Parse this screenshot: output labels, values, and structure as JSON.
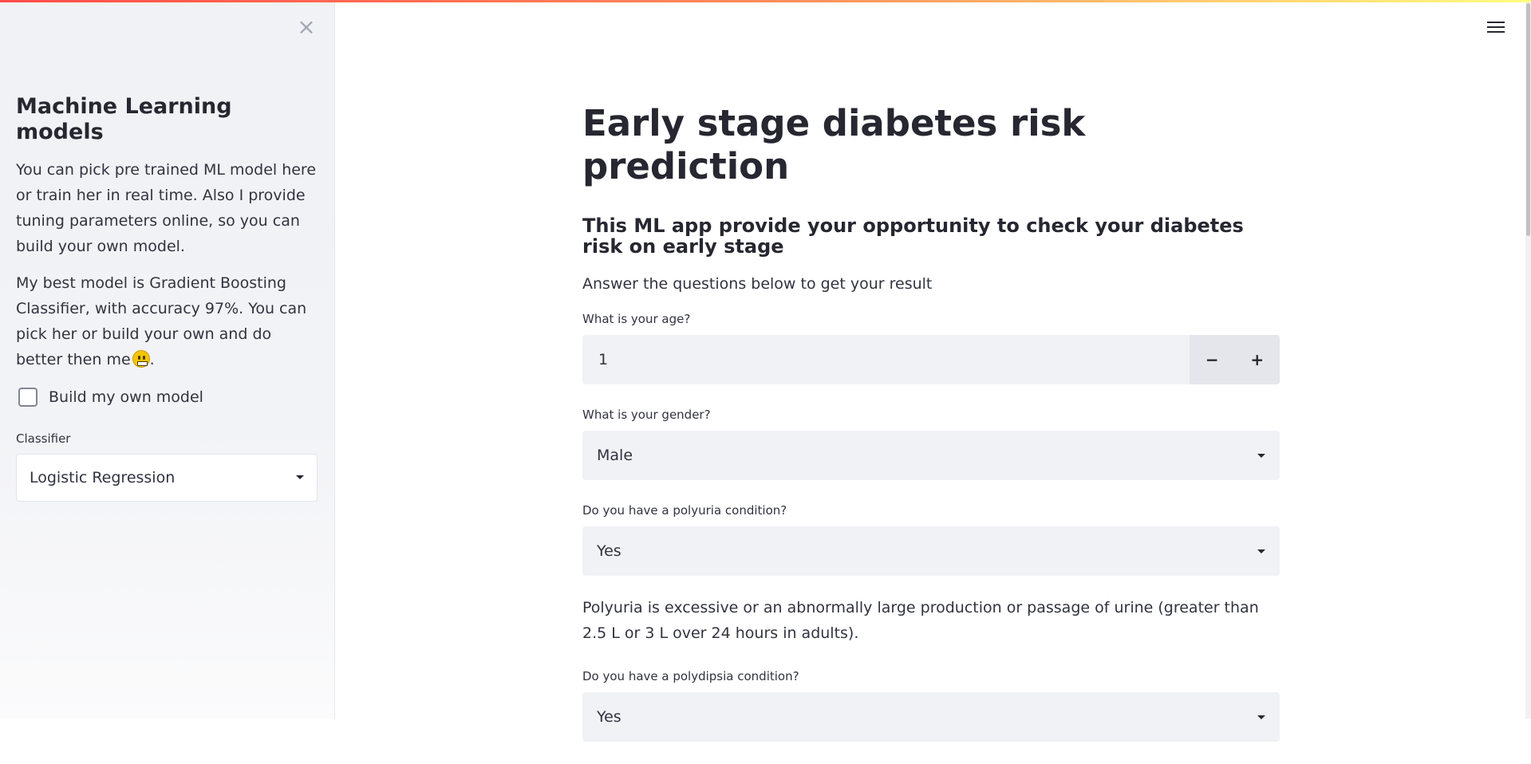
{
  "sidebar": {
    "title": "Machine Learning models",
    "para1": "You can pick pre trained ML model here or train her in real time. Also I provide tuning parameters online, so you can build your own model.",
    "para2": "My best model is Gradient Boosting Classifier, with accuracy 97%. You can pick her or build your own and do better then me",
    "para2_end": ".",
    "emoji": "grinning-face-icon",
    "checkbox_label": "Build my own model",
    "checkbox_checked": false,
    "classifier_label": "Classifier",
    "classifier_value": "Logistic Regression"
  },
  "main": {
    "title": "Early stage diabetes risk prediction",
    "subtitle": "This ML app provide your opportunity to check your diabetes risk on early stage",
    "intro": "Answer the questions below to get your result",
    "age": {
      "label": "What is your age?",
      "value": "1",
      "decrement": "−",
      "increment": "+"
    },
    "gender": {
      "label": "What is your gender?",
      "value": "Male"
    },
    "polyuria": {
      "label": "Do you have a polyuria condition?",
      "value": "Yes",
      "info": "Polyuria is excessive or an abnormally large production or passage of urine (greater than 2.5 L or 3 L over 24 hours in adults)."
    },
    "polydipsia": {
      "label": "Do you have a polydipsia condition?",
      "value": "Yes"
    }
  },
  "colors": {
    "accent_gradient_start": "#ff4b4b",
    "accent_gradient_end": "#fffd80",
    "sidebar_bg": "#f0f2f6",
    "input_bg": "#f0f2f6",
    "text": "#262730"
  },
  "icons": {
    "close": "close-icon",
    "menu": "hamburger-menu-icon",
    "dropdown": "chevron-down-icon"
  }
}
